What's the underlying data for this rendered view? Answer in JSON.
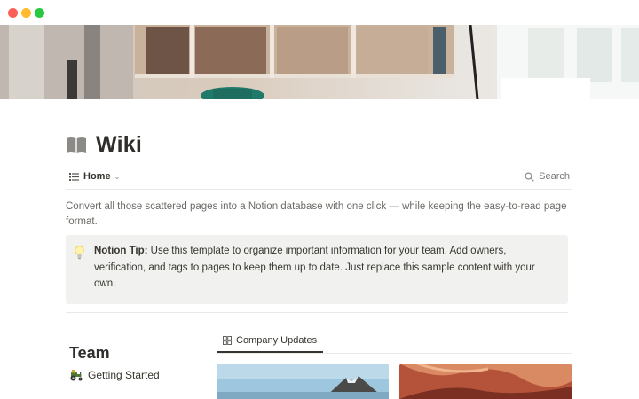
{
  "window": {
    "controls": [
      "close",
      "minimize",
      "zoom"
    ],
    "colors": {
      "close": "#fe5f57",
      "minimize": "#febc2e",
      "zoom": "#28c840"
    }
  },
  "cover": {
    "description_icon": "office-cover-image"
  },
  "page": {
    "icon": "book-icon",
    "title": "Wiki"
  },
  "viewbar": {
    "home_label": "Home",
    "search_label": "Search"
  },
  "intro": "Convert all those scattered pages into a Notion database with one click — while keeping the easy-to-read page format.",
  "callout": {
    "icon": "lightbulb-icon",
    "label": "Notion Tip:",
    "text": " Use this template to organize important information for your team. Add owners, verification, and tags to pages to keep them up to date. Just replace this sample content with your own."
  },
  "team": {
    "heading": "Team",
    "items": [
      {
        "icon": "tractor-icon",
        "label": "Getting Started"
      }
    ]
  },
  "gallery": {
    "tab_label": "Company Updates",
    "tab_icon": "gallery-grid-icon",
    "cards": [
      {
        "image": "mountain-image"
      },
      {
        "image": "canyon-image"
      }
    ]
  }
}
